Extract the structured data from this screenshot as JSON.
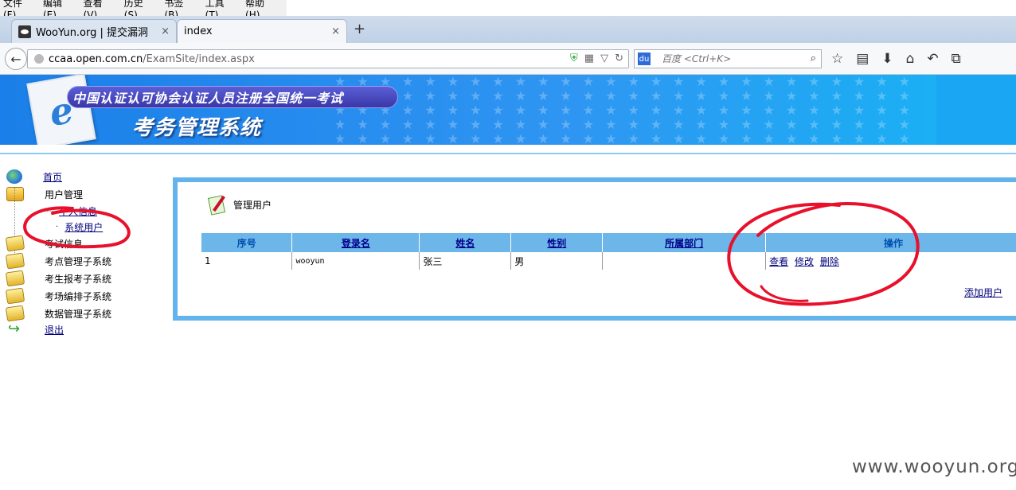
{
  "browser": {
    "menu": [
      "文件(F)",
      "编辑(E)",
      "查看(V)",
      "历史(S)",
      "书签(B)",
      "工具(T)",
      "帮助(H)"
    ],
    "tabs": [
      {
        "title": "WooYun.org | 提交漏洞",
        "close": "×"
      },
      {
        "title": "index",
        "close": "×"
      }
    ],
    "new_tab": "+",
    "url_host": "ccaa.open.com.cn",
    "url_path": "/ExamSite/index.aspx",
    "search_placeholder": "百度 <Ctrl+K>",
    "search_engine_label": "du"
  },
  "banner": {
    "headline": "中国认证认可协会认证人员注册全国统一考试",
    "system_title": "考务管理系统"
  },
  "nav": {
    "home": "首页",
    "user_mgmt": "用户管理",
    "user_mgmt_child1": "个人信息",
    "user_mgmt_child2": "系统用户",
    "exam_info": "考试信息",
    "site_mgmt": "考点管理子系统",
    "candidate_signup": "考生报考子系统",
    "room_schedule": "考场编排子系统",
    "data_mgmt": "数据管理子系统",
    "logout": "退出"
  },
  "panel": {
    "title": "管理用户",
    "columns": {
      "seq": "序号",
      "login": "登录名",
      "name": "姓名",
      "gender": "性别",
      "dept": "所属部门",
      "ops": "操作"
    },
    "rows": [
      {
        "seq": "1",
        "login": "wooyun",
        "name": "张三",
        "gender": "男",
        "dept": "",
        "view": "查看",
        "edit": "修改",
        "delete": "删除"
      }
    ],
    "add_user": "添加用户"
  },
  "watermark": "www.wooyun.org",
  "colors": {
    "banner_blue": "#1a7fe8",
    "panel_border": "#63b3ec",
    "header_fill": "#6cb6ea",
    "annotation_red": "#e8102a",
    "link": "#00007c"
  }
}
